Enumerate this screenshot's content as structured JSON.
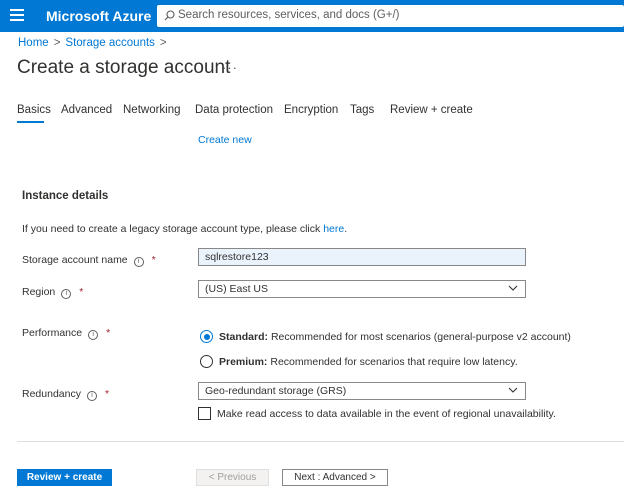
{
  "app": {
    "brand": "Microsoft Azure",
    "search_placeholder": "Search resources, services, and docs (G+/)"
  },
  "breadcrumb": {
    "items": [
      "Home",
      "Storage accounts"
    ]
  },
  "page": {
    "title": "Create a storage account",
    "more": "···"
  },
  "tabs": [
    {
      "label": "Basics",
      "active": true
    },
    {
      "label": "Advanced"
    },
    {
      "label": "Networking"
    },
    {
      "label": "Data protection"
    },
    {
      "label": "Encryption"
    },
    {
      "label": "Tags"
    },
    {
      "label": "Review + create"
    }
  ],
  "create_new_link": "Create new",
  "instance": {
    "section_title": "Instance details",
    "legacy_text": "If you need to create a legacy storage account type, please click",
    "legacy_link": "here",
    "legacy_period": "."
  },
  "fields": {
    "name": {
      "label": "Storage account name",
      "value": "sqlrestore123",
      "required": "*"
    },
    "region": {
      "label": "Region",
      "value": "(US) East US",
      "required": "*"
    },
    "performance": {
      "label": "Performance",
      "required": "*",
      "options": [
        {
          "bold": "Standard:",
          "text": "Recommended for most scenarios (general-purpose v2 account)",
          "selected": true
        },
        {
          "bold": "Premium:",
          "text": "Recommended for scenarios that require low latency.",
          "selected": false
        }
      ]
    },
    "redundancy": {
      "label": "Redundancy",
      "required": "*",
      "value": "Geo-redundant storage (GRS)",
      "checkbox_label": "Make read access to data available in the event of regional unavailability.",
      "checkbox_checked": false
    }
  },
  "footer": {
    "review_create": "Review + create",
    "previous": "< Previous",
    "next": "Next : Advanced >"
  },
  "colors": {
    "accent": "#0078d4",
    "required": "#a4262c"
  }
}
